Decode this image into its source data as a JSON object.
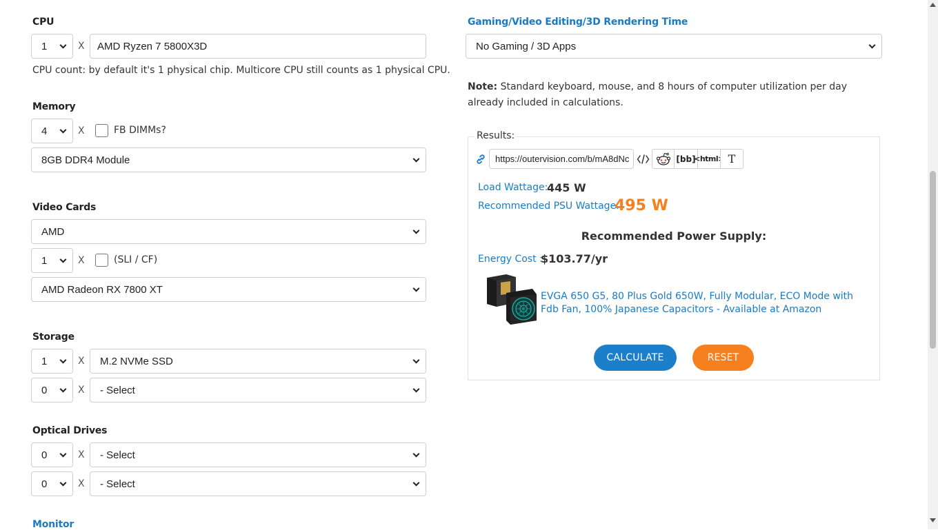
{
  "cpu": {
    "label": "CPU",
    "count": "1",
    "model": "AMD Ryzen 7 5800X3D",
    "note": "CPU count: by default it's 1 physical chip. Multicore CPU still counts as 1 physical CPU."
  },
  "memory": {
    "label": "Memory",
    "count": "4",
    "fb_dimms_label": "FB DIMMs?",
    "fb_dimms_checked": false,
    "module": "8GB DDR4 Module"
  },
  "video": {
    "label": "Video Cards",
    "brand": "AMD",
    "count": "1",
    "sli_label": "(SLI / CF)",
    "sli_checked": false,
    "model": "AMD Radeon RX 7800 XT"
  },
  "storage": {
    "label": "Storage",
    "rows": [
      {
        "count": "1",
        "type": "M.2 NVMe SSD"
      },
      {
        "count": "0",
        "type": "- Select"
      }
    ]
  },
  "optical": {
    "label": "Optical Drives",
    "rows": [
      {
        "count": "0",
        "type": "- Select"
      },
      {
        "count": "0",
        "type": "- Select"
      }
    ]
  },
  "monitor": {
    "label": "Monitor"
  },
  "multiply_sign": "X",
  "gaming": {
    "label": "Gaming/Video Editing/3D Rendering Time",
    "value": "No Gaming / 3D Apps"
  },
  "note": {
    "bold": "Note:",
    "text": " Standard keyboard, mouse, and 8 hours of computer utilization per day already included in calculations."
  },
  "results": {
    "legend": "Results:",
    "share_url": "https://outervision.com/b/mA8dNc",
    "share_buttons": {
      "bb": "[bb]",
      "html": "<html>",
      "text": "T"
    },
    "load_label": "Load Wattage:",
    "load_value": "445 W",
    "psu_label": "Recommended PSU Wattage:",
    "psu_value": "495 W",
    "rec_heading": "Recommended Power Supply:",
    "energy_label": "Energy Cost :",
    "energy_value": "$103.77/yr",
    "product_link": "EVGA 650 G5, 80 Plus Gold 650W, Fully Modular, ECO Mode with Fdb Fan, 100% Japanese Capacitors - Available at Amazon",
    "calculate_label": "CALCULATE",
    "reset_label": "RESET"
  },
  "colors": {
    "link_blue": "#1a7bc4",
    "psu_orange": "#f7801e",
    "calculate_bg": "#1b7fcb",
    "reset_bg": "#f7801e"
  }
}
